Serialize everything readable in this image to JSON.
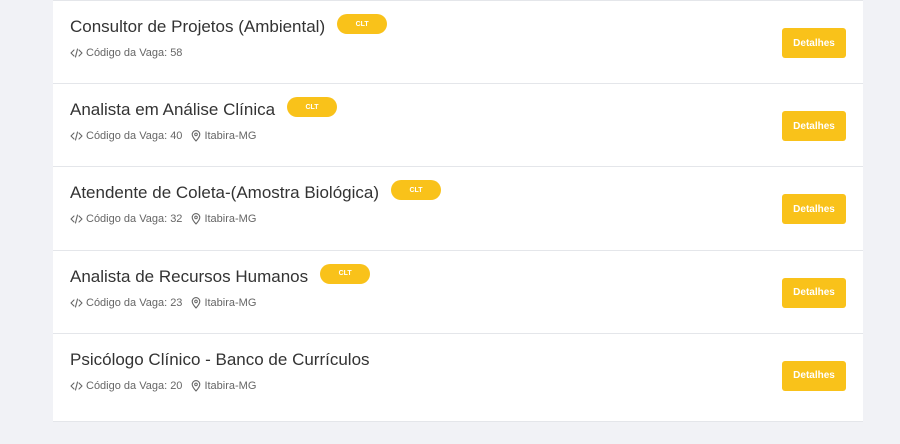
{
  "jobs": [
    {
      "title": "Consultor de Projetos (Ambiental)",
      "badge": "CLT",
      "code_label": "Código da Vaga: 58",
      "location": "",
      "details_label": "Detalhes"
    },
    {
      "title": "Analista em Análise Clínica",
      "badge": "CLT",
      "code_label": "Código da Vaga: 40",
      "location": "Itabira-MG",
      "details_label": "Detalhes"
    },
    {
      "title": "Atendente de Coleta-(Amostra Biológica)",
      "badge": "CLT",
      "code_label": "Código da Vaga: 32",
      "location": "Itabira-MG",
      "details_label": "Detalhes"
    },
    {
      "title": "Analista de Recursos Humanos",
      "badge": "CLT",
      "code_label": "Código da Vaga: 23",
      "location": "Itabira-MG",
      "details_label": "Detalhes"
    },
    {
      "title": "Psicólogo Clínico - Banco de Currículos",
      "badge": "",
      "code_label": "Código da Vaga: 20",
      "location": "Itabira-MG",
      "details_label": "Detalhes"
    }
  ],
  "icons": {
    "code": "code-icon",
    "location": "map-pin-icon"
  },
  "colors": {
    "accent": "#f9c21a",
    "page_background": "#f1f2f6",
    "title_text": "#333333",
    "meta_text": "#666666"
  }
}
